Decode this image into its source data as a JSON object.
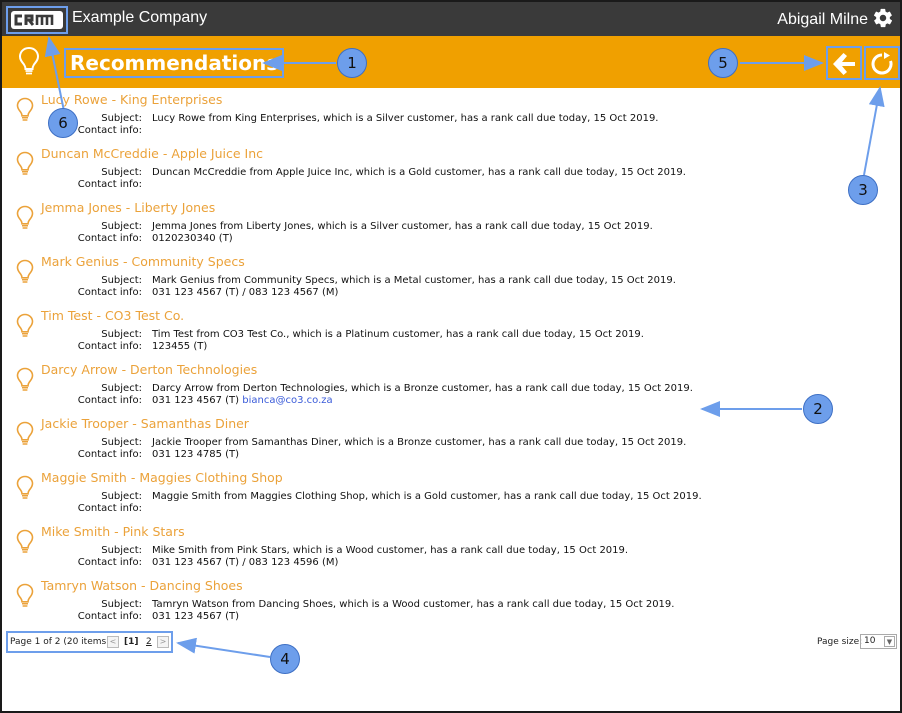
{
  "topbar": {
    "company": "Example Company",
    "user": "Abigail Milne",
    "logo_icon": "crm-logo",
    "settings_icon": "gear-icon"
  },
  "header": {
    "title": "Recommendations",
    "back_icon": "arrow-left-icon",
    "refresh_icon": "refresh-icon"
  },
  "labels": {
    "subject": "Subject:",
    "contact": "Contact info:"
  },
  "items": [
    {
      "title": "Lucy Rowe - King Enterprises",
      "subject": "Lucy Rowe from King Enterprises, which is a Silver customer, has a rank call due today, 15 Oct 2019.",
      "contact": ""
    },
    {
      "title": "Duncan McCreddie - Apple Juice Inc",
      "subject": "Duncan McCreddie from Apple Juice Inc, which is a Gold customer, has a rank call due today, 15 Oct 2019.",
      "contact": ""
    },
    {
      "title": "Jemma Jones - Liberty Jones",
      "subject": "Jemma Jones from Liberty Jones, which is a Silver customer, has a rank call due today, 15 Oct 2019.",
      "contact": "0120230340 (T)"
    },
    {
      "title": "Mark Genius - Community Specs",
      "subject": "Mark Genius from Community Specs, which is a Metal customer, has a rank call due today, 15 Oct 2019.",
      "contact": "031 123 4567 (T) / 083 123 4567 (M)"
    },
    {
      "title": "Tim Test - CO3 Test Co.",
      "subject": "Tim Test from CO3 Test Co., which is a Platinum customer, has a rank call due today, 15 Oct 2019.",
      "contact": "123455 (T)"
    },
    {
      "title": "Darcy Arrow - Derton Technologies",
      "subject": "Darcy Arrow from Derton Technologies, which is a Bronze customer, has a rank call due today, 15 Oct 2019.",
      "contact": "031 123 4567 (T)",
      "email": "bianca@co3.co.za"
    },
    {
      "title": "Jackie Trooper - Samanthas Diner",
      "subject": "Jackie Trooper from Samanthas Diner, which is a Bronze customer, has a rank call due today, 15 Oct 2019.",
      "contact": "031 123 4785 (T)"
    },
    {
      "title": "Maggie Smith - Maggies Clothing Shop",
      "subject": "Maggie Smith from Maggies Clothing Shop, which is a Gold customer, has a rank call due today, 15 Oct 2019.",
      "contact": ""
    },
    {
      "title": "Mike Smith - Pink Stars",
      "subject": "Mike Smith from Pink Stars, which is a Wood customer, has a rank call due today, 15 Oct 2019.",
      "contact": "031 123 4567 (T) / 083 123 4596 (M)"
    },
    {
      "title": "Tamryn Watson - Dancing Shoes",
      "subject": "Tamryn Watson from Dancing Shoes, which is a Wood customer, has a rank call due today, 15 Oct 2019.",
      "contact": "031 123 4567 (T)"
    }
  ],
  "pager": {
    "summary": "Page 1 of 2 (20 items)",
    "prev": "<",
    "current": "[1]",
    "page2": "2",
    "next": ">",
    "page_size_label": "Page size:",
    "page_size_value": "10"
  },
  "callouts": [
    "1",
    "2",
    "3",
    "4",
    "5",
    "6"
  ],
  "colors": {
    "topbar": "#3a3a3a",
    "header": "#f0a000",
    "item_title": "#eba23a",
    "annotation": "#6d9eeb"
  }
}
